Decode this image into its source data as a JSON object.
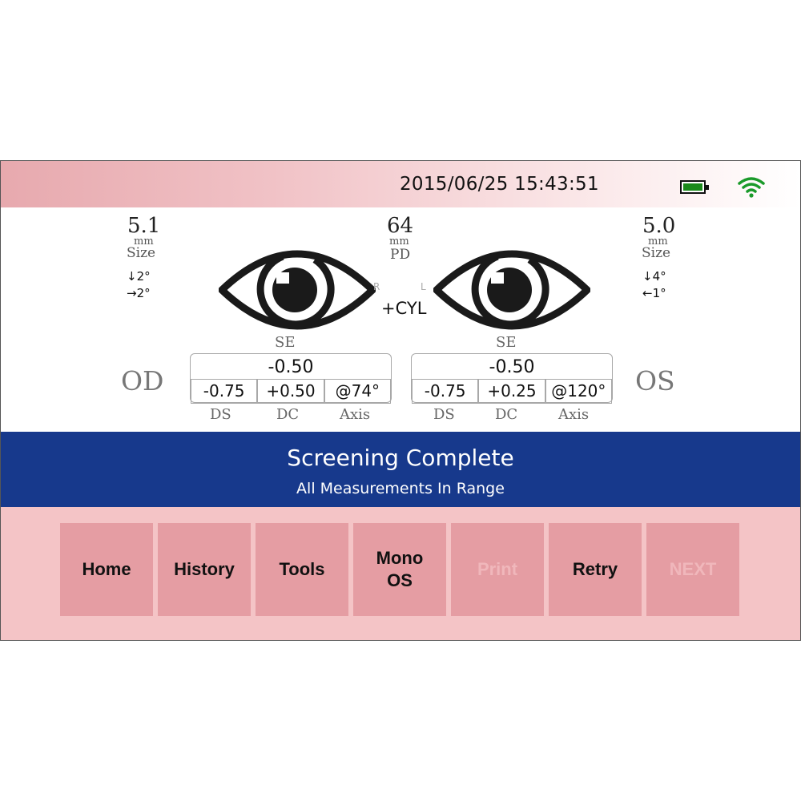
{
  "status_bar": {
    "datetime": "2015/06/25 15:43:51",
    "battery_icon": "battery-full-icon",
    "wifi_icon": "wifi-icon",
    "battery_color": "#1a8a1a",
    "wifi_color": "#1a9a2a"
  },
  "right_eye": {
    "size_value": "5.1",
    "size_unit": "mm",
    "size_label": "Size",
    "gaze_vertical": "↓2°",
    "gaze_horizontal": "→2°",
    "side_label": "OD",
    "eye_letter": "R",
    "se_label": "SE",
    "se_value": "-0.50",
    "ds": "-0.75",
    "dc": "+0.50",
    "axis": "@74°"
  },
  "left_eye": {
    "size_value": "5.0",
    "size_unit": "mm",
    "size_label": "Size",
    "gaze_vertical": "↓4°",
    "gaze_horizontal": "←1°",
    "side_label": "OS",
    "eye_letter": "L",
    "se_label": "SE",
    "se_value": "-0.50",
    "ds": "-0.75",
    "dc": "+0.25",
    "axis": "@120°"
  },
  "pd": {
    "value": "64",
    "unit": "mm",
    "label": "PD"
  },
  "cyl_mode": "+CYL",
  "column_headers": {
    "ds": "DS",
    "dc": "DC",
    "axis": "Axis"
  },
  "banner": {
    "title": "Screening Complete",
    "subtitle": "All Measurements In Range",
    "color": "#17398c"
  },
  "nav": {
    "home": "Home",
    "history": "History",
    "tools": "Tools",
    "mono": "Mono\nOS",
    "print": "Print",
    "retry": "Retry",
    "next": "NEXT"
  }
}
